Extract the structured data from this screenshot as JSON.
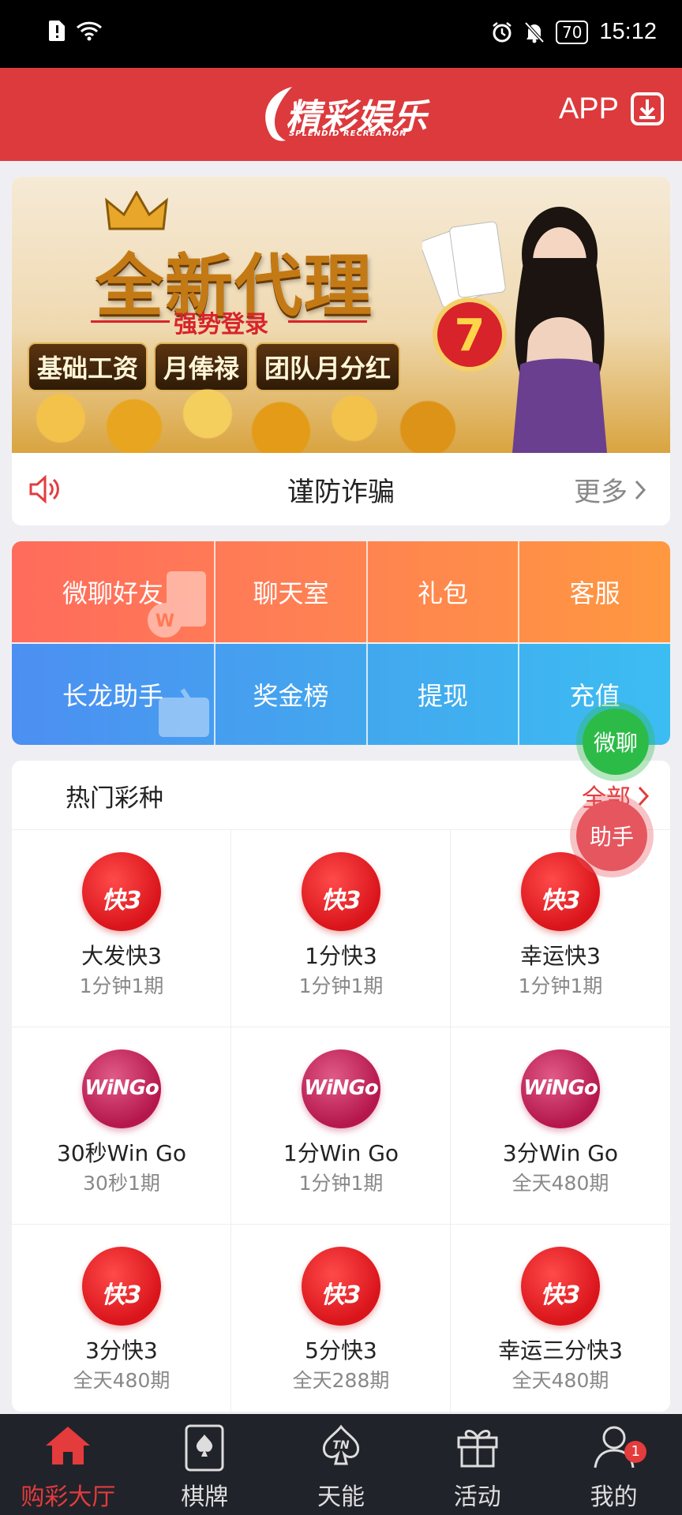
{
  "status_bar": {
    "time": "15:12",
    "battery": "70"
  },
  "header": {
    "logo_text": "精彩娱乐",
    "logo_sub": "SPLENDID RECREATION",
    "app_label": "APP"
  },
  "banner": {
    "title": "全新代理",
    "subtitle": "强势登录",
    "pills": [
      "基础工资",
      "月俸禄",
      "团队月分红"
    ]
  },
  "notice": {
    "text": "谨防诈骗",
    "more_label": "更多"
  },
  "quick_menu": {
    "row1": [
      "微聊好友",
      "聊天室",
      "礼包",
      "客服"
    ],
    "row2": [
      "长龙助手",
      "奖金榜",
      "提现",
      "充值"
    ]
  },
  "hot_games": {
    "title": "热门彩种",
    "all_label": "全部",
    "items": [
      {
        "icon": "快3",
        "icon_type": "k3",
        "name": "大发快3",
        "period": "1分钟1期"
      },
      {
        "icon": "快3",
        "icon_type": "k3",
        "name": "1分快3",
        "period": "1分钟1期"
      },
      {
        "icon": "快3",
        "icon_type": "k3",
        "name": "幸运快3",
        "period": "1分钟1期"
      },
      {
        "icon": "WiNGo",
        "icon_type": "wg",
        "name": "30秒Win Go",
        "period": "30秒1期"
      },
      {
        "icon": "WiNGo",
        "icon_type": "wg",
        "name": "1分Win Go",
        "period": "1分钟1期"
      },
      {
        "icon": "WiNGo",
        "icon_type": "wg",
        "name": "3分Win Go",
        "period": "全天480期"
      },
      {
        "icon": "快3",
        "icon_type": "k3",
        "name": "3分快3",
        "period": "全天480期"
      },
      {
        "icon": "快3",
        "icon_type": "k3",
        "name": "5分快3",
        "period": "全天288期"
      },
      {
        "icon": "快3",
        "icon_type": "k3",
        "name": "幸运三分快3",
        "period": "全天480期"
      }
    ]
  },
  "floating": {
    "chat_label": "微聊",
    "help_label": "助手"
  },
  "tab_bar": {
    "items": [
      {
        "label": "购彩大厅",
        "icon": "home-icon",
        "active": true
      },
      {
        "label": "棋牌",
        "icon": "cards-icon",
        "active": false
      },
      {
        "label": "天能",
        "icon": "spade-icon",
        "active": false
      },
      {
        "label": "活动",
        "icon": "gift-icon",
        "active": false
      },
      {
        "label": "我的",
        "icon": "user-icon",
        "active": false,
        "badge": "1"
      }
    ]
  },
  "colors": {
    "brand_red": "#dc3a3d",
    "tab_bg": "#21232a",
    "accent_red": "#e43b3d"
  }
}
